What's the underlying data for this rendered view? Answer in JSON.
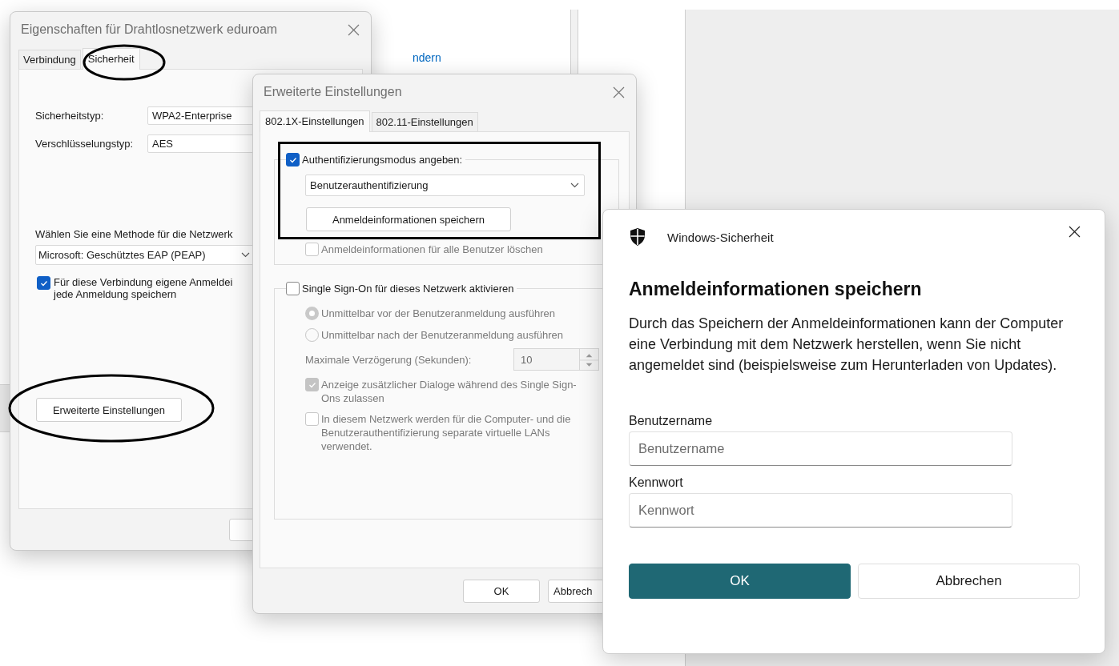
{
  "background_window": {
    "link": "ndern"
  },
  "properties_window": {
    "title": "Eigenschaften für Drahtlosnetzwerk eduroam",
    "tabs": [
      {
        "label": "Verbindung",
        "selected": false
      },
      {
        "label": "Sicherheit",
        "selected": true
      }
    ],
    "fields": [
      {
        "label": "Sicherheitstyp:",
        "value": "WPA2-Enterprise"
      },
      {
        "label": "Verschlüsselungstyp:",
        "value": "AES"
      }
    ],
    "method_label": "Wählen Sie eine Methode für die Netzwerk",
    "method_select": "Microsoft: Geschütztes EAP (PEAP)",
    "remember": {
      "lines": [
        "Für diese Verbindung eigene Anmeldei",
        "jede Anmeldung speichern"
      ],
      "checked": true
    },
    "advanced_button": "Erweiterte Einstellungen"
  },
  "advanced_window": {
    "title": "Erweiterte Einstellungen",
    "tabs": [
      {
        "label": "802.1X-Einstellungen",
        "selected": true
      },
      {
        "label": "802.11-Einstellungen",
        "selected": false
      }
    ],
    "auth": {
      "label": "Authentifizierungsmodus angeben:",
      "checked": true
    },
    "auth_mode": "Benutzerauthentifizierung",
    "save_button": "Anmeldeinformationen speichern",
    "clear": {
      "label": "Anmeldeinformationen für alle Benutzer löschen",
      "checked": false,
      "disabled": true
    },
    "sso": {
      "label": "Single Sign-On für dieses Netzwerk aktivieren",
      "checked": false
    },
    "radios": [
      {
        "label": "Unmittelbar vor der Benutzeranmeldung ausführen",
        "selected": true,
        "disabled": true
      },
      {
        "label": "Unmittelbar nach der Benutzeranmeldung ausführen",
        "selected": false,
        "disabled": true
      }
    ],
    "delay": {
      "label": "Maximale Verzögerung (Sekunden):",
      "value": "10",
      "disabled": true
    },
    "options": [
      {
        "label": "Anzeige zusätzlicher Dialoge während des Single Sign-Ons zulassen",
        "checked": true,
        "disabled": true
      },
      {
        "label": "In diesem Netzwerk werden für die Computer- und die Benutzerauthentifizierung separate virtuelle LANs verwendet.",
        "checked": false,
        "disabled": true
      }
    ],
    "buttons": [
      "OK",
      "Abbrech"
    ]
  },
  "security_dialog": {
    "app_name": "Windows-Sicherheit",
    "heading": "Anmeldeinformationen speichern",
    "description": "Durch das Speichern der Anmeldeinformationen kann der Computer eine Verbindung mit dem Netzwerk herstellen, wenn Sie nicht angemeldet sind (beispielsweise zum Herunterladen von Updates).",
    "fields": [
      {
        "label": "Benutzername",
        "placeholder": "Benutzername"
      },
      {
        "label": "Kennwort",
        "placeholder": "Kennwort"
      }
    ],
    "buttons": [
      {
        "label": "OK",
        "kind": "primary"
      },
      {
        "label": "Abbrechen",
        "kind": "secondary"
      }
    ]
  }
}
